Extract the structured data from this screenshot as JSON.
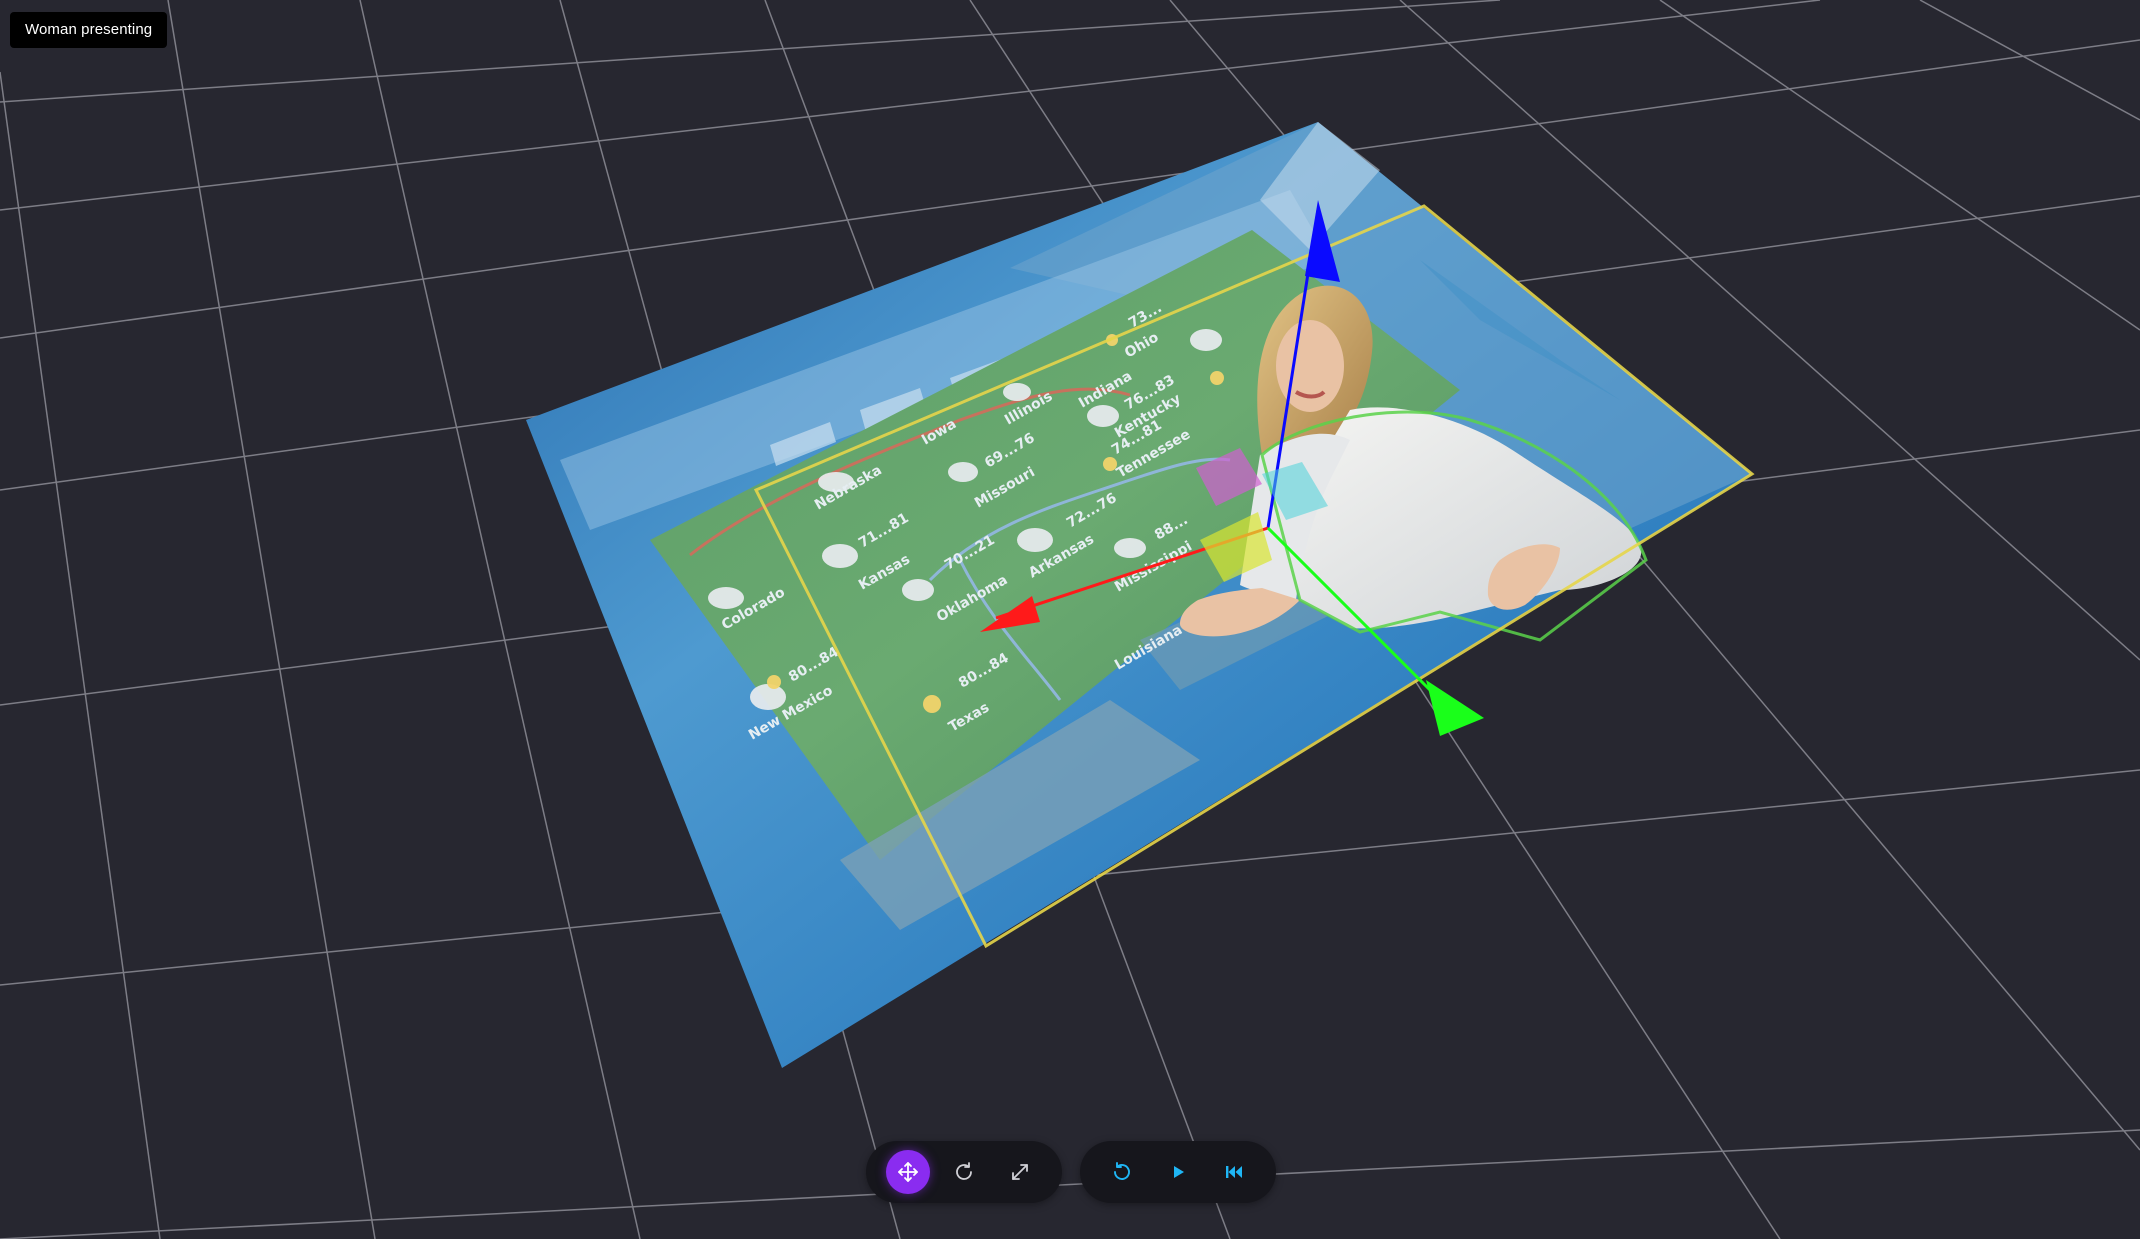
{
  "object": {
    "name": "Woman presenting"
  },
  "map_labels": {
    "nebraska": "Nebraska",
    "iowa": "Iowa",
    "illinois": "Illinois",
    "indiana": "Indiana",
    "ohio": "Ohio",
    "kentucky": "Kentucky",
    "colorado": "Colorado",
    "kansas": "Kansas",
    "missouri": "Missouri",
    "tennessee": "Tennessee",
    "oklahoma": "Oklahoma",
    "arkansas": "Arkansas",
    "mississippi": "Mississippi",
    "new_mexico": "New Mexico",
    "texas": "Texas",
    "louisiana": "Louisiana",
    "t_kansas": "71...81",
    "t_missouri": "69...76",
    "t_kentucky": "76...83",
    "t_tennessee": "74...81",
    "t_arkansas": "72...76",
    "t_oklahoma": "70...21",
    "t_texas": "80...84",
    "t_new_mexico": "80...84",
    "t_ohio": "73...",
    "t_mississippi": "88..."
  },
  "toolbar": {
    "transform_tools": [
      {
        "id": "move",
        "icon": "move-arrows-icon",
        "active": true
      },
      {
        "id": "rotate",
        "icon": "rotate-icon",
        "active": false
      },
      {
        "id": "scale",
        "icon": "scale-expand-icon",
        "active": false
      }
    ],
    "playback_tools": [
      {
        "id": "loop",
        "icon": "loop-icon"
      },
      {
        "id": "play",
        "icon": "play-icon"
      },
      {
        "id": "rewind",
        "icon": "skip-back-icon"
      }
    ]
  },
  "colors": {
    "background": "#272730",
    "grid": "#9a9aa3",
    "accent_active": "#8a2cf0",
    "playback_icon": "#1fb6f5",
    "axis_x": "#ff1a1a",
    "axis_y": "#0a0aff",
    "axis_z": "#1aff1a",
    "selection_outline": "#e5d54a"
  }
}
